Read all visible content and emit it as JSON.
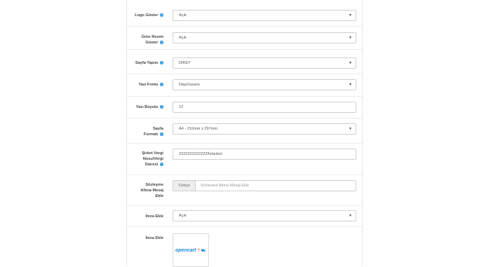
{
  "fields": {
    "logo": {
      "label": "Logo Göster",
      "value": "Açık"
    },
    "product_image": {
      "label_line1": "Ürün Resmi",
      "label_line2": "Göster",
      "value": "Açık"
    },
    "page_layout": {
      "label": "Sayfa Yapısı",
      "value": "DİKEY"
    },
    "font": {
      "label": "Yazı Fontu",
      "value": "DejaVusans"
    },
    "font_size": {
      "label": "Yazı Boyutu",
      "value": "12"
    },
    "page_format": {
      "label_line1": "Sayfa",
      "label_line2": "Formatı",
      "value": "A4 - 210mm x 297mm"
    },
    "tax": {
      "label_line1": "Şirket Vergi",
      "label_line2": "Nosu/Vergi",
      "label_line3": "Dairesi",
      "value": "2222222222222/İstanbul"
    },
    "contract": {
      "label_line1": "Sözleşme",
      "label_line2": "Altına Mesaj",
      "label_line3": "Ekle",
      "addon": "Türkçe",
      "placeholder": "Sözleşme Altına Mesaj Ekle"
    },
    "signature": {
      "label": "İmza Ekle",
      "value": "Açık"
    },
    "signature_image": {
      "label": "İmza Ekle",
      "logo_text": "opencart"
    }
  },
  "icons": {
    "help": "question-circle-icon",
    "dropdown": "caret-down-icon",
    "cart": "cart-icon"
  },
  "colors": {
    "help": "#2a8fd3",
    "logo": "#1d8ad6"
  }
}
